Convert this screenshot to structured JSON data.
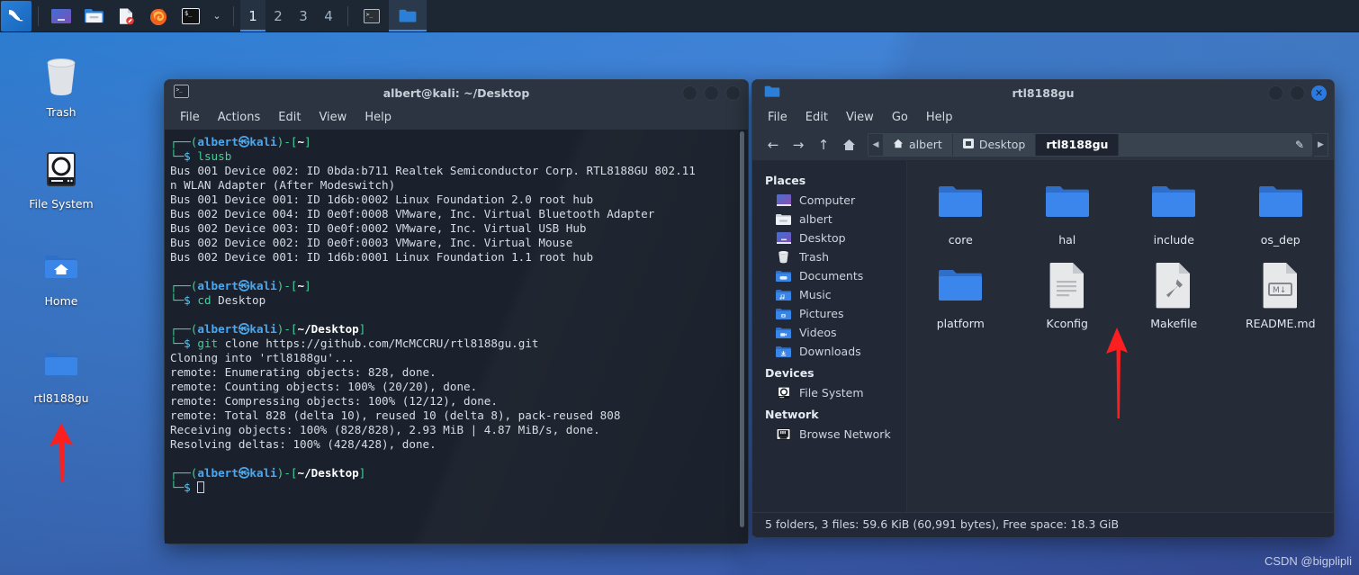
{
  "desktop": {
    "wallpaper_color": "#3b7fd4",
    "watermark": "CSDN @bigplipli",
    "icons": [
      {
        "label": "Trash",
        "icon": "trash-icon"
      },
      {
        "label": "File System",
        "icon": "harddisk-icon"
      },
      {
        "label": "Home",
        "icon": "home-folder-icon"
      },
      {
        "label": "rtl8188gu",
        "icon": "folder-icon"
      }
    ]
  },
  "taskbar": {
    "background": "#1c2733",
    "launchers": [
      {
        "name": "kali-menu-icon",
        "label": "Kali"
      },
      {
        "name": "show-desktop-icon",
        "label": "Show Desktop"
      },
      {
        "name": "file-manager-icon",
        "label": "File Manager"
      },
      {
        "name": "text-editor-icon",
        "label": "Text Editor"
      },
      {
        "name": "firefox-icon",
        "label": "Firefox"
      },
      {
        "name": "terminal-icon",
        "label": "Terminal"
      }
    ],
    "chevron": "⌄",
    "workspaces": [
      "1",
      "2",
      "3",
      "4"
    ],
    "active_workspace": "1",
    "windows": [
      {
        "name": "taskbar-window-terminal",
        "icon": "terminal-icon",
        "active": false
      },
      {
        "name": "taskbar-window-filemanager",
        "icon": "folder-icon",
        "active": true
      }
    ]
  },
  "terminal": {
    "title": "albert@kali: ~/Desktop",
    "icon": "terminal-icon",
    "menu": [
      "File",
      "Actions",
      "Edit",
      "View",
      "Help"
    ],
    "window_buttons": [
      "minimize",
      "maximize",
      "close"
    ],
    "lines": [
      {
        "type": "prompt",
        "user": "albert",
        "host": "kali",
        "path": "~"
      },
      {
        "type": "cmd",
        "cmd": "lsusb",
        "args": ""
      },
      {
        "type": "out",
        "text": "Bus 001 Device 002: ID 0bda:b711 Realtek Semiconductor Corp. RTL8188GU 802.11"
      },
      {
        "type": "out",
        "text": "n WLAN Adapter (After Modeswitch)"
      },
      {
        "type": "out",
        "text": "Bus 001 Device 001: ID 1d6b:0002 Linux Foundation 2.0 root hub"
      },
      {
        "type": "out",
        "text": "Bus 002 Device 004: ID 0e0f:0008 VMware, Inc. Virtual Bluetooth Adapter"
      },
      {
        "type": "out",
        "text": "Bus 002 Device 003: ID 0e0f:0002 VMware, Inc. Virtual USB Hub"
      },
      {
        "type": "out",
        "text": "Bus 002 Device 002: ID 0e0f:0003 VMware, Inc. Virtual Mouse"
      },
      {
        "type": "out",
        "text": "Bus 002 Device 001: ID 1d6b:0001 Linux Foundation 1.1 root hub"
      },
      {
        "type": "blank",
        "text": " "
      },
      {
        "type": "prompt",
        "user": "albert",
        "host": "kali",
        "path": "~"
      },
      {
        "type": "cmd",
        "cmd": "cd",
        "args": "Desktop"
      },
      {
        "type": "blank",
        "text": " "
      },
      {
        "type": "prompt",
        "user": "albert",
        "host": "kali",
        "path": "~/Desktop"
      },
      {
        "type": "cmd",
        "cmd": "git",
        "args": "clone https://github.com/McMCCRU/rtl8188gu.git"
      },
      {
        "type": "out",
        "text": "Cloning into 'rtl8188gu'..."
      },
      {
        "type": "out",
        "text": "remote: Enumerating objects: 828, done."
      },
      {
        "type": "out",
        "text": "remote: Counting objects: 100% (20/20), done."
      },
      {
        "type": "out",
        "text": "remote: Compressing objects: 100% (12/12), done."
      },
      {
        "type": "out",
        "text": "remote: Total 828 (delta 10), reused 10 (delta 8), pack-reused 808"
      },
      {
        "type": "out",
        "text": "Receiving objects: 100% (828/828), 2.93 MiB | 4.87 MiB/s, done."
      },
      {
        "type": "out",
        "text": "Resolving deltas: 100% (428/428), done."
      },
      {
        "type": "blank",
        "text": " "
      },
      {
        "type": "prompt",
        "user": "albert",
        "host": "kali",
        "path": "~/Desktop"
      },
      {
        "type": "cursor",
        "text": ""
      }
    ]
  },
  "filemanager": {
    "title": "rtl8188gu",
    "icon": "folder-icon",
    "menu": [
      "File",
      "Edit",
      "View",
      "Go",
      "Help"
    ],
    "nav_buttons": [
      "back-arrow",
      "forward-arrow",
      "up-arrow",
      "home"
    ],
    "breadcrumbs": [
      {
        "label": "albert",
        "icon": "home-icon",
        "active": false
      },
      {
        "label": "Desktop",
        "icon": "desktop-icon",
        "active": false
      },
      {
        "label": "rtl8188gu",
        "icon": "",
        "active": true
      }
    ],
    "sidebar": {
      "sections": [
        {
          "title": "Places",
          "items": [
            {
              "label": "Computer",
              "icon": "computer-icon"
            },
            {
              "label": "albert",
              "icon": "home-folder-icon"
            },
            {
              "label": "Desktop",
              "icon": "desktop-icon"
            },
            {
              "label": "Trash",
              "icon": "trash-icon"
            },
            {
              "label": "Documents",
              "icon": "documents-folder-icon"
            },
            {
              "label": "Music",
              "icon": "music-folder-icon"
            },
            {
              "label": "Pictures",
              "icon": "pictures-folder-icon"
            },
            {
              "label": "Videos",
              "icon": "videos-folder-icon"
            },
            {
              "label": "Downloads",
              "icon": "downloads-folder-icon"
            }
          ]
        },
        {
          "title": "Devices",
          "items": [
            {
              "label": "File System",
              "icon": "harddisk-icon"
            }
          ]
        },
        {
          "title": "Network",
          "items": [
            {
              "label": "Browse Network",
              "icon": "network-icon"
            }
          ]
        }
      ]
    },
    "files": [
      {
        "name": "core",
        "type": "folder"
      },
      {
        "name": "hal",
        "type": "folder"
      },
      {
        "name": "include",
        "type": "folder"
      },
      {
        "name": "os_dep",
        "type": "folder"
      },
      {
        "name": "platform",
        "type": "folder"
      },
      {
        "name": "Kconfig",
        "type": "text-file"
      },
      {
        "name": "Makefile",
        "type": "makefile"
      },
      {
        "name": "README.md",
        "type": "markdown-file"
      }
    ],
    "status": "5 folders, 3 files: 59.6 KiB (60,991 bytes), Free space: 18.3 GiB"
  },
  "annotations": {
    "arrow_color": "#fb1f1f",
    "arrows": [
      {
        "name": "arrow-pointing-to-rtl8188gu-desktop-folder"
      },
      {
        "name": "arrow-pointing-to-makefile"
      }
    ]
  }
}
